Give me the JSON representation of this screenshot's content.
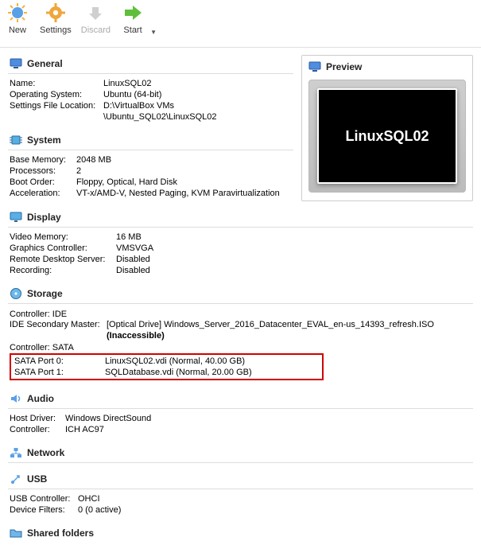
{
  "toolbar": {
    "new": "New",
    "settings": "Settings",
    "discard": "Discard",
    "start": "Start"
  },
  "sections": {
    "general": "General",
    "system": "System",
    "preview": "Preview",
    "display": "Display",
    "storage": "Storage",
    "audio": "Audio",
    "network": "Network",
    "usb": "USB",
    "shared": "Shared folders"
  },
  "general": {
    "name_k": "Name:",
    "name_v": "LinuxSQL02",
    "os_k": "Operating System:",
    "os_v": "Ubuntu (64-bit)",
    "settings_loc_k": "Settings File Location:",
    "settings_loc_v1": "D:\\VirtualBox VMs",
    "settings_loc_v2": "\\Ubuntu_SQL02\\LinuxSQL02"
  },
  "system": {
    "mem_k": "Base Memory:",
    "mem_v": "2048 MB",
    "proc_k": "Processors:",
    "proc_v": "2",
    "boot_k": "Boot Order:",
    "boot_v": "Floppy, Optical, Hard Disk",
    "accel_k": "Acceleration:",
    "accel_v": "VT-x/AMD-V, Nested Paging, KVM Paravirtualization"
  },
  "preview": {
    "machine": "LinuxSQL02"
  },
  "display": {
    "vmem_k": "Video Memory:",
    "vmem_v": "16 MB",
    "gctrl_k": "Graphics Controller:",
    "gctrl_v": "VMSVGA",
    "rds_k": "Remote Desktop Server:",
    "rds_v": "Disabled",
    "rec_k": "Recording:",
    "rec_v": "Disabled"
  },
  "storage": {
    "ctrl_ide": "Controller: IDE",
    "ide_sec_k": "IDE Secondary Master:",
    "ide_sec_v": "[Optical Drive] Windows_Server_2016_Datacenter_EVAL_en-us_14393_refresh.ISO",
    "inaccessible": "(Inaccessible)",
    "ctrl_sata": "Controller: SATA",
    "sata0_k": "SATA Port 0:",
    "sata0_v": "LinuxSQL02.vdi (Normal, 40.00 GB)",
    "sata1_k": "SATA Port 1:",
    "sata1_v": "SQLDatabase.vdi (Normal, 20.00 GB)"
  },
  "audio": {
    "host_k": "Host Driver:",
    "host_v": "Windows DirectSound",
    "ctrl_k": "Controller:",
    "ctrl_v": "ICH AC97"
  },
  "usb": {
    "ctrl_k": "USB Controller:",
    "ctrl_v": "OHCI",
    "flt_k": "Device Filters:",
    "flt_v": "0 (0 active)"
  }
}
